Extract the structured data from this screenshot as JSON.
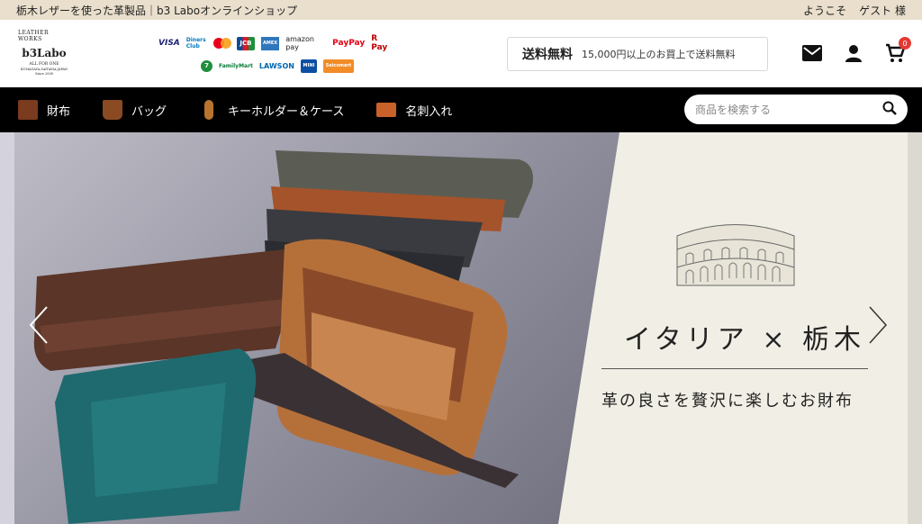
{
  "topbar": {
    "tagline": "栃木レザーを使った革製品｜b3 Laboオンラインショップ",
    "welcome": "ようこそ",
    "guest": "ゲスト 様"
  },
  "logo": {
    "arc": "LEATHER WORKS",
    "brand": "b3Labo",
    "tag": "ALL FOR ONE",
    "tag2": "KUMAGAYA,SAITAMA,JAPAN",
    "since": "Since 2008"
  },
  "payments": {
    "row1": [
      "VISA",
      "Diners Club",
      "",
      "JCB",
      "AMEX",
      "amazon pay",
      "PayPay",
      "R Pay"
    ],
    "row2": [
      "7",
      "FamilyMart",
      "LAWSON",
      "MINI",
      "Seicomart"
    ]
  },
  "shipping": {
    "free_label": "送料無料",
    "note": "15,000円以上のお買上で送料無料"
  },
  "header_icons": {
    "cart_count": "0"
  },
  "nav": {
    "items": [
      {
        "label": "財布",
        "color": "#7a3b1f"
      },
      {
        "label": "バッグ",
        "color": "#8a4a22"
      },
      {
        "label": "キーホルダー＆ケース",
        "color": "#b8742f"
      },
      {
        "label": "名刺入れ",
        "color": "#c8612a"
      }
    ],
    "search_placeholder": "商品を検索する"
  },
  "hero": {
    "title": "イタリア × 栃木",
    "subtitle": "革の良さを贅沢に楽しむお財布"
  }
}
